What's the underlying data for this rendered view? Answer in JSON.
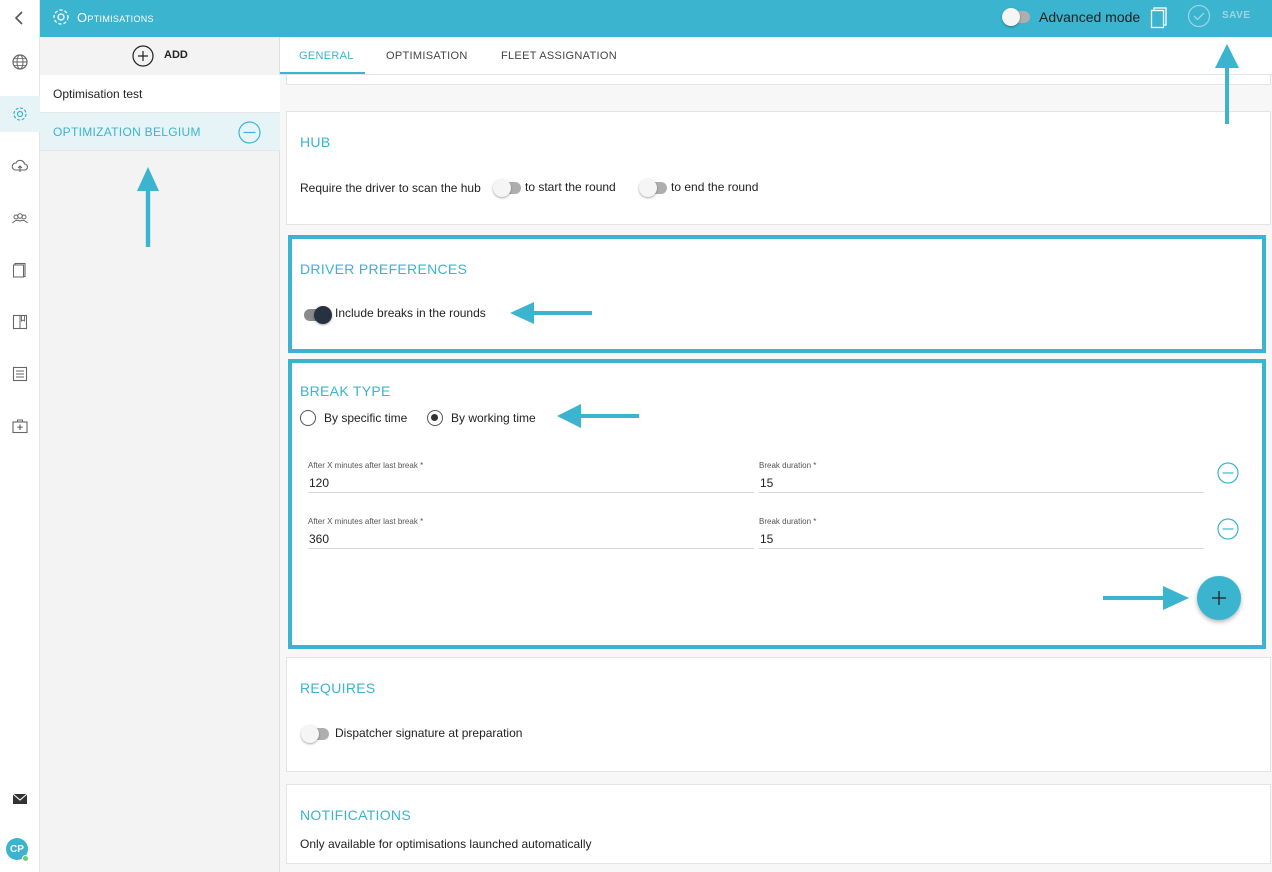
{
  "colors": {
    "accent": "#3ab4cf",
    "arrow": "#3ab4cf"
  },
  "app": {
    "title": "Optimisations",
    "advanced_mode_label": "Advanced mode",
    "advanced_mode_on": false,
    "save_label": "SAVE"
  },
  "rail": {
    "items": [
      "back-icon",
      "globe-icon",
      "settings-icon",
      "cloud-upload-icon",
      "team-icon",
      "document-icon",
      "book-icon",
      "list-icon",
      "medkit-icon",
      "mail-icon"
    ],
    "avatar": "CP"
  },
  "list": {
    "add_label": "ADD",
    "items": [
      {
        "label": "Optimisation test",
        "selected": false
      },
      {
        "label": "OPTIMIZATION BELGIUM",
        "selected": true
      }
    ]
  },
  "tabs": [
    {
      "label": "GENERAL",
      "active": true
    },
    {
      "label": "OPTIMISATION",
      "active": false
    },
    {
      "label": "FLEET ASSIGNATION",
      "active": false
    }
  ],
  "hub": {
    "title": "HUB",
    "scan_label": "Require the driver to scan the hub",
    "start_label": "to start the round",
    "end_label": "to end the round",
    "start_on": false,
    "end_on": false
  },
  "driver_prefs": {
    "title": "DRIVER PREFERENCES",
    "breaks_label": "Include breaks in the rounds",
    "breaks_on": true
  },
  "break_type": {
    "title": "BREAK TYPE",
    "options": [
      {
        "label": "By specific time",
        "selected": false
      },
      {
        "label": "By working time",
        "selected": true
      }
    ],
    "rows": [
      {
        "after_label": "After X minutes after last break",
        "after_value": "120",
        "duration_label": "Break duration",
        "duration_value": "15"
      },
      {
        "after_label": "After X minutes after last break",
        "after_value": "360",
        "duration_label": "Break duration",
        "duration_value": "15"
      }
    ],
    "required_mark": "*"
  },
  "requires": {
    "title": "REQUIRES",
    "signature_label": "Dispatcher signature at preparation",
    "signature_on": false
  },
  "notifications": {
    "title": "NOTIFICATIONS",
    "note": "Only available for optimisations launched automatically"
  }
}
